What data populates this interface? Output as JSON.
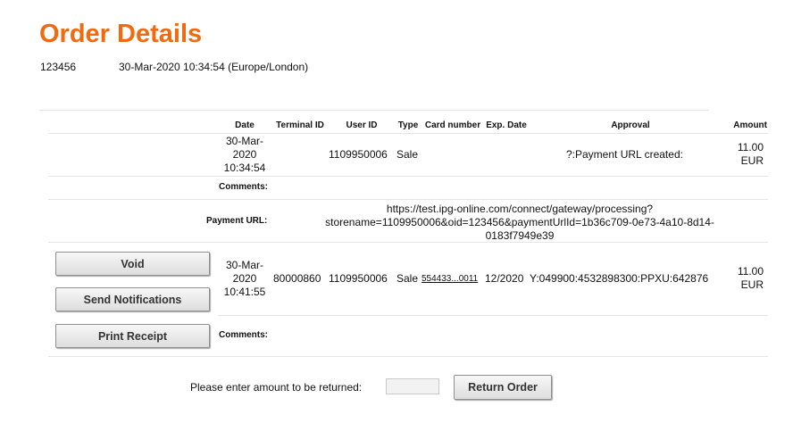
{
  "page": {
    "title": "Order Details",
    "order_id": "123456",
    "order_timestamp": "30-Mar-2020 10:34:54 (Europe/London)"
  },
  "table": {
    "headers": {
      "date": "Date",
      "terminal_id": "Terminal ID",
      "user_id": "User ID",
      "type": "Type",
      "card_number": "Card number",
      "exp_date": "Exp. Date",
      "approval": "Approval",
      "amount": "Amount"
    },
    "row1": {
      "date_line1": "30-Mar-",
      "date_line2": "2020",
      "date_line3": "10:34:54",
      "terminal_id": "",
      "user_id": "1109950006",
      "type": "Sale",
      "approval": "?:Payment URL created:",
      "amount_line1": "11.00",
      "amount_line2": "EUR",
      "comments_label": "Comments:",
      "payment_url_label": "Payment URL:",
      "payment_url_line1": "https://test.ipg-online.com/connect/gateway/processing?",
      "payment_url_line2": "storename=1109950006&oid=123456&paymentUrlId=1b36c709-0e73-4a10-8d14-",
      "payment_url_line3": "0183f7949e39"
    },
    "row2": {
      "date_line1": "30-Mar-",
      "date_line2": "2020",
      "date_line3": "10:41:55",
      "terminal_id": "80000860",
      "user_id": "1109950006",
      "type": "Sale",
      "card_number": "554433...0011",
      "exp_date": "12/2020",
      "approval": "Y:049900:4532898300:PPXU:642876",
      "amount_line1": "11.00",
      "amount_line2": "EUR",
      "comments_label": "Comments:"
    }
  },
  "actions": {
    "void_label": "Void",
    "send_notifications_label": "Send Notifications",
    "print_receipt_label": "Print Receipt"
  },
  "return": {
    "prompt": "Please enter amount to be returned:",
    "amount_value": "",
    "button_label": "Return Order"
  },
  "colors": {
    "accent": "#f26a10"
  }
}
